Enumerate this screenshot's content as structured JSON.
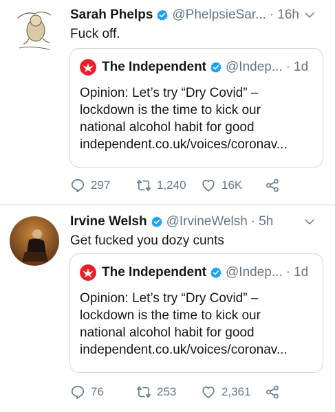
{
  "tweets": [
    {
      "author": {
        "name": "Sarah Phelps",
        "handle": "@PhelpsieSar...",
        "avatar_icon": "cartoon-figure-avatar"
      },
      "time": "16h",
      "text": "Fuck off.",
      "quote": {
        "name": "The Independent",
        "handle": "@Indep...",
        "time": "1d",
        "lines": [
          "Opinion: Let’s try “Dry Covid” –",
          "lockdown is the time to kick our",
          "national alcohol habit for good",
          "independent.co.uk/voices/coronav..."
        ]
      },
      "stats": {
        "replies": "297",
        "retweets": "1,240",
        "likes": "16K"
      }
    },
    {
      "author": {
        "name": "Irvine Welsh",
        "handle": "@IrvineWelsh",
        "avatar_icon": "photo-avatar"
      },
      "time": "5h",
      "text": "Get fucked you dozy cunts",
      "quote": {
        "name": "The Independent",
        "handle": "@Indep...",
        "time": "1d",
        "lines": [
          "Opinion: Let’s try “Dry Covid” –",
          "lockdown is the time to kick our",
          "national alcohol habit for good",
          "independent.co.uk/voices/coronav..."
        ]
      },
      "stats": {
        "replies": "76",
        "retweets": "253",
        "likes": "2,361"
      }
    }
  ],
  "separator": "·",
  "colors": {
    "verified": "#1da1f2",
    "secondary": "#657786",
    "border": "#ccd6dd",
    "independent_red": "#e8202a"
  }
}
